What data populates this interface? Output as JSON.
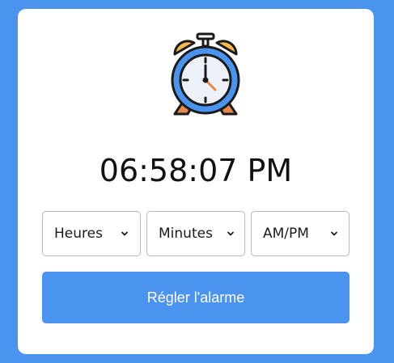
{
  "clock": {
    "icon": "alarm-clock-icon",
    "time": "06:58:07 PM"
  },
  "selects": {
    "hours": {
      "label": "Heures",
      "icon": "chevron-down-icon"
    },
    "minutes": {
      "label": "Minutes",
      "icon": "chevron-down-icon"
    },
    "ampm": {
      "label": "AM/PM",
      "icon": "chevron-down-icon"
    }
  },
  "actions": {
    "set_alarm_label": "Régler l'alarme"
  },
  "colors": {
    "background": "#4a94f0",
    "button": "#4a94f0",
    "card": "#ffffff",
    "clock_face": "#4a94f0",
    "clock_bells": "#f6b94a",
    "clock_legs": "#e58a48"
  }
}
